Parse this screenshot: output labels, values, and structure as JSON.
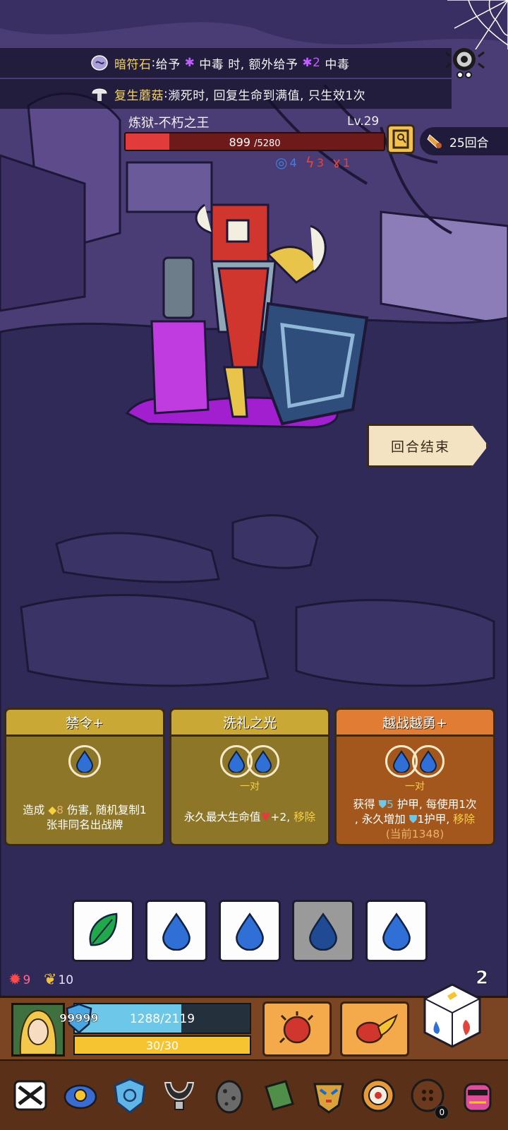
{
  "relics_info": [
    {
      "name": "暗符石",
      "text_a": "给予",
      "text_b": "中毒 时, 额外给予",
      "value": "2",
      "text_c": "中毒"
    },
    {
      "name": "复生蘑菇",
      "text": "濒死时, 回复生命到满值, 只生效1次"
    }
  ],
  "boss": {
    "name": "炼狱-不朽之王",
    "level": "Lv.29",
    "hp_current": "899",
    "hp_max": "/5280",
    "hp_fraction": 0.17,
    "intents": [
      {
        "icon": "swirl-icon",
        "value": "4",
        "color": "#3b82e6"
      },
      {
        "icon": "claw-icon",
        "value": "3",
        "color": "#e2453b"
      },
      {
        "icon": "fist-icon",
        "value": "1",
        "color": "#e2453b"
      }
    ]
  },
  "round": {
    "label": "25回合"
  },
  "end_turn": {
    "label": "回合结束"
  },
  "cards": [
    {
      "title": "禁令+",
      "desc_a": "造成",
      "desc_value": "8",
      "desc_b": "伤害, 随机复制1",
      "desc_c": "张非同名出战牌"
    },
    {
      "title": "洗礼之光",
      "pair": "一对",
      "desc_a": "永久最大生命值",
      "desc_value": "+2,",
      "desc_remove": "移除"
    },
    {
      "title": "越战越勇+",
      "pair": "一对",
      "line1_a": "获得",
      "line1_value": "5",
      "line1_b": "护甲, 每使用1次",
      "line2_a": ", 永久增加",
      "line2_value": "1",
      "line2_b": "护甲,",
      "line2_remove": "移除",
      "line3": "(当前1348)"
    }
  ],
  "dice": [
    {
      "face": "leaf",
      "used": false
    },
    {
      "face": "drop",
      "used": false
    },
    {
      "face": "drop",
      "used": false
    },
    {
      "face": "drop",
      "used": true
    },
    {
      "face": "drop",
      "used": false
    }
  ],
  "player": {
    "stat_a": "9",
    "stat_b": "10",
    "shield": "99999",
    "hp_text": "1288/2119",
    "hp_fraction": 0.61,
    "energy_text": "30/30",
    "energy_fraction": 1.0,
    "dice_count": "2"
  },
  "relic_tray": [
    {
      "icon": "skull-emblem-icon",
      "color": "#1a1a1a"
    },
    {
      "icon": "blue-sunflower-icon",
      "color": "#3a6bd0"
    },
    {
      "icon": "blue-shield-icon",
      "color": "#5fb6e6"
    },
    {
      "icon": "dark-collar-icon",
      "color": "#2b2b2b"
    },
    {
      "icon": "stone-egg-icon",
      "color": "#6a6a6a"
    },
    {
      "icon": "green-book-icon",
      "color": "#4f8f4a"
    },
    {
      "icon": "tribal-mask-icon",
      "color": "#d9a23a"
    },
    {
      "icon": "target-ring-icon",
      "color": "#e89a3a"
    },
    {
      "icon": "wooden-button-icon",
      "color": "#6b3a1e",
      "badge": "0"
    },
    {
      "icon": "pink-demon-icon",
      "color": "#e04c9a"
    }
  ]
}
